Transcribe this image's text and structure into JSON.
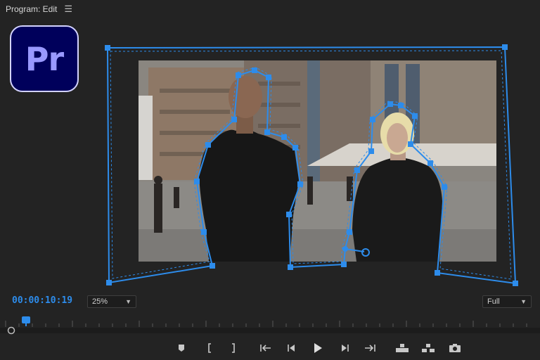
{
  "panel": {
    "title": "Program: Edit",
    "menu_icon": "hamburger-icon"
  },
  "logo": {
    "text": "Pr",
    "bg": "#00005b",
    "fg": "#9999ff"
  },
  "timecode": "00:00:10:19",
  "zoom": {
    "selected": "25%"
  },
  "quality": {
    "selected": "Full"
  },
  "accent": "#2d8ceb",
  "transport": [
    {
      "name": "add-marker-icon"
    },
    {
      "name": "mark-in-icon"
    },
    {
      "name": "mark-out-icon"
    },
    {
      "name": "go-to-in-icon"
    },
    {
      "name": "step-back-icon"
    },
    {
      "name": "play-icon"
    },
    {
      "name": "step-forward-icon"
    },
    {
      "name": "go-to-out-icon"
    },
    {
      "name": "lift-icon"
    },
    {
      "name": "extract-icon"
    },
    {
      "name": "export-frame-icon"
    }
  ]
}
